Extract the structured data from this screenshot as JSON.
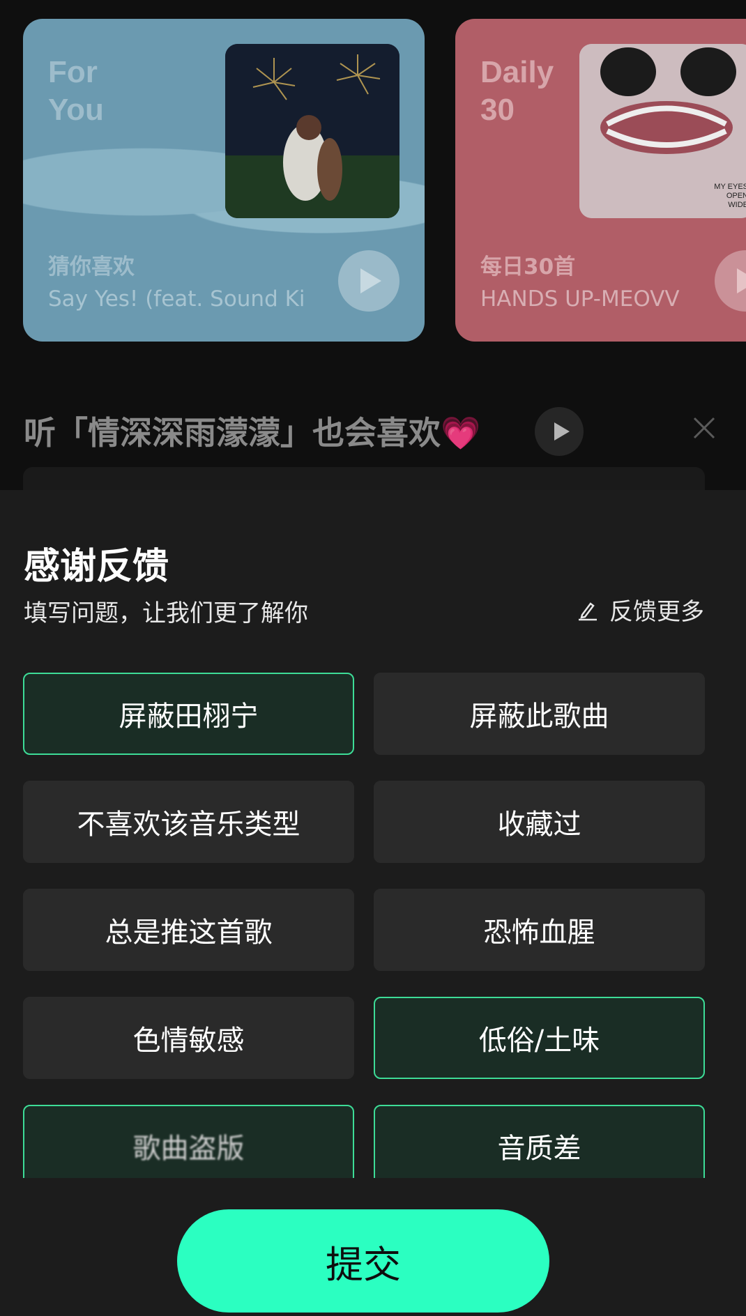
{
  "colors": {
    "accent": "#2bffc1",
    "selected_border": "#3ddc97",
    "selected_bg": "#1a2d25",
    "sheet_bg": "#1c1c1c"
  },
  "cards": [
    {
      "title": "For\nYou",
      "subtitle": "猜你喜欢",
      "track": "Say Yes! (feat. Sound Ki"
    },
    {
      "title": "Daily\n30",
      "subtitle": "每日30首",
      "track": "HANDS UP-MEOVV"
    }
  ],
  "album_art_text": [
    "MY EYES",
    "OPEN",
    "WIDE"
  ],
  "recommend": {
    "title": "听「情深深雨濛濛」也会喜欢💗"
  },
  "sheet": {
    "title": "感谢反馈",
    "subtitle": "填写问题，让我们更了解你",
    "more_label": "反馈更多",
    "options": [
      {
        "label": "屏蔽田栩宁",
        "selected": true
      },
      {
        "label": "屏蔽此歌曲",
        "selected": false
      },
      {
        "label": "不喜欢该音乐类型",
        "selected": false
      },
      {
        "label": "收藏过",
        "selected": false
      },
      {
        "label": "总是推这首歌",
        "selected": false
      },
      {
        "label": "恐怖血腥",
        "selected": false
      },
      {
        "label": "色情敏感",
        "selected": false
      },
      {
        "label": "低俗/土味",
        "selected": true
      },
      {
        "label": "歌曲盗版",
        "selected": true
      },
      {
        "label": "音质差",
        "selected": true
      }
    ],
    "submit_label": "提交"
  }
}
